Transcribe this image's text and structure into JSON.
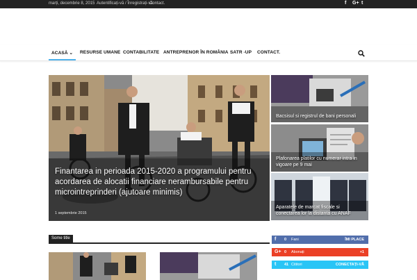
{
  "topbar": {
    "date": "marți, decembrie 8, 2015",
    "auth": "Autentificați-vă / Înregistrați-vă",
    "contact": "Contact.",
    "social_icons": [
      "facebook-icon",
      "google-plus-icon",
      "twitter-icon"
    ],
    "facebook_glyph": "f",
    "google_glyph": "G+",
    "twitter_glyph": "t"
  },
  "nav": {
    "items": [
      {
        "label": "ACASĂ"
      },
      {
        "label": "RESURSE UMANE"
      },
      {
        "label": "CONTABILITATE"
      },
      {
        "label": "ANTREPRENOR ÎN ROMÂNIA"
      },
      {
        "label": "SATR -UP"
      },
      {
        "label": "CONTACT."
      }
    ],
    "active_index": 0,
    "dropdown_glyph": "⌄"
  },
  "hero": {
    "title": "Finantarea in perioada 2015-2020 a programului pentru acordarea de alocatii financiare nerambursabile pentru microintreprinderi (ajutoare minimis)",
    "date": "1 septembrie 2015"
  },
  "side_posts": [
    {
      "title": "Bacsisul si registrul de bani personali"
    },
    {
      "title": "Plafonarea platilor cu numerar intra in vigoare pe 9 mai"
    },
    {
      "title": "Aparatele de marcat fiscale si conectarea lor la distanta cu ANAF"
    }
  ],
  "block": {
    "title": "Some title"
  },
  "social_counters": [
    {
      "icon": "facebook-icon",
      "glyph": "f",
      "count": "0",
      "label": "Fani",
      "action": "ÎMI PLACE",
      "color": "#516eab"
    },
    {
      "icon": "google-plus-icon",
      "glyph": "G+",
      "count": "0",
      "label": "Abonați",
      "action": "+1",
      "color": "#eb4026"
    },
    {
      "icon": "twitter-icon",
      "glyph": "t",
      "count": "41",
      "label": "Cititori",
      "action": "CONECTAȚI-VĂ",
      "color": "#29c5f6"
    }
  ],
  "colors": {
    "accent": "#4db2ec",
    "topbar": "#222222"
  }
}
